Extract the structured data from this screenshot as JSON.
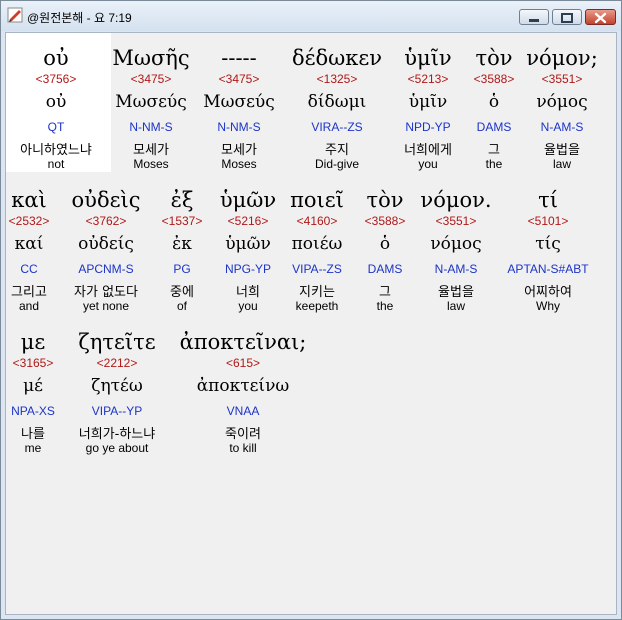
{
  "window": {
    "title": "@원전본해 - 요 7:19"
  },
  "rows": [
    {
      "words": [
        {
          "greek": "οὐ",
          "strong": "<3756>",
          "lemma": "οὐ",
          "morph": "QT",
          "korean": "아니하였느냐",
          "english": "not"
        },
        {
          "greek": "Μωσῆς",
          "strong": "<3475>",
          "lemma": "Μωσεύς",
          "morph": "N-NM-S",
          "korean": "모세가",
          "english": "Moses"
        },
        {
          "greek": "-----",
          "strong": "<3475>",
          "lemma": "Μωσεύς",
          "morph": "N-NM-S",
          "korean": "모세가",
          "english": "Moses"
        },
        {
          "greek": "δέδωκεν",
          "strong": "<1325>",
          "lemma": "δίδωμι",
          "morph": "VIRA--ZS",
          "korean": "주지",
          "english": "Did-give"
        },
        {
          "greek": "ὑμῖν",
          "strong": "<5213>",
          "lemma": "ὑμῖν",
          "morph": "NPD-YP",
          "korean": "너희에게",
          "english": "you"
        },
        {
          "greek": "τὸν",
          "strong": "<3588>",
          "lemma": "ὁ",
          "morph": "DAMS",
          "korean": "그",
          "english": "the"
        },
        {
          "greek": "νόμον;",
          "strong": "<3551>",
          "lemma": "νόμος",
          "morph": "N-AM-S",
          "korean": "율법을",
          "english": "law"
        }
      ]
    },
    {
      "words": [
        {
          "greek": "καὶ",
          "strong": "<2532>",
          "lemma": "καί",
          "morph": "CC",
          "korean": "그리고",
          "english": "and"
        },
        {
          "greek": "οὐδεὶς",
          "strong": "<3762>",
          "lemma": "οὐδείς",
          "morph": "APCNM-S",
          "korean": "자가 없도다",
          "english": "yet none"
        },
        {
          "greek": "ἐξ",
          "strong": "<1537>",
          "lemma": "ἐκ",
          "morph": "PG",
          "korean": "중에",
          "english": "of"
        },
        {
          "greek": "ὑμῶν",
          "strong": "<5216>",
          "lemma": "ὑμῶν",
          "morph": "NPG-YP",
          "korean": "너희",
          "english": "you"
        },
        {
          "greek": "ποιεῖ",
          "strong": "<4160>",
          "lemma": "ποιέω",
          "morph": "VIPA--ZS",
          "korean": "지키는",
          "english": "keepeth"
        },
        {
          "greek": "τὸν",
          "strong": "<3588>",
          "lemma": "ὁ",
          "morph": "DAMS",
          "korean": "그",
          "english": "the"
        },
        {
          "greek": "νόμον.",
          "strong": "<3551>",
          "lemma": "νόμος",
          "morph": "N-AM-S",
          "korean": "율법을",
          "english": "law"
        },
        {
          "greek": "τί",
          "strong": "<5101>",
          "lemma": "τίς",
          "morph": "APTAN-S#ABT",
          "korean": "어찌하여",
          "english": "Why"
        }
      ]
    },
    {
      "words": [
        {
          "greek": "με",
          "strong": "<3165>",
          "lemma": "μέ",
          "morph": "NPA-XS",
          "korean": "나를",
          "english": "me"
        },
        {
          "greek": "ζητεῖτε",
          "strong": "<2212>",
          "lemma": "ζητέω",
          "morph": "VIPA--YP",
          "korean": "너희가-하느냐",
          "english": "go ye about"
        },
        {
          "greek": "ἀποκτεῖναι;",
          "strong": "<615>",
          "lemma": "ἀποκτείνω",
          "morph": "VNAA",
          "korean": "죽이려",
          "english": "to kill"
        }
      ]
    }
  ]
}
